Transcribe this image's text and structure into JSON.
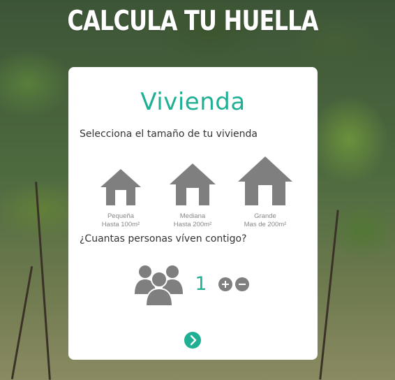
{
  "page": {
    "title": "CALCULA TU HUELLA"
  },
  "card": {
    "title": "Vivienda",
    "size_prompt": "Selecciona el tamaño de tu vivienda",
    "sizes": [
      {
        "name": "Pequeña",
        "detail": "Hasta 100m²",
        "icon": "house-icon"
      },
      {
        "name": "Mediana",
        "detail": "Hasta 200m²",
        "icon": "house-icon"
      },
      {
        "name": "Grande",
        "detail": "Mas de 200m²",
        "icon": "house-icon"
      }
    ],
    "people_prompt": "¿Cuantas personas víven contigo?",
    "people_icon": "group-icon",
    "people_count": "1",
    "increment_icon": "plus-circle-icon",
    "decrement_icon": "minus-circle-icon",
    "next_icon": "chevron-right-icon"
  },
  "colors": {
    "accent": "#1fb093",
    "icon_gray": "#7f7f7f",
    "label_gray": "#888888",
    "card_bg": "#ffffff"
  }
}
